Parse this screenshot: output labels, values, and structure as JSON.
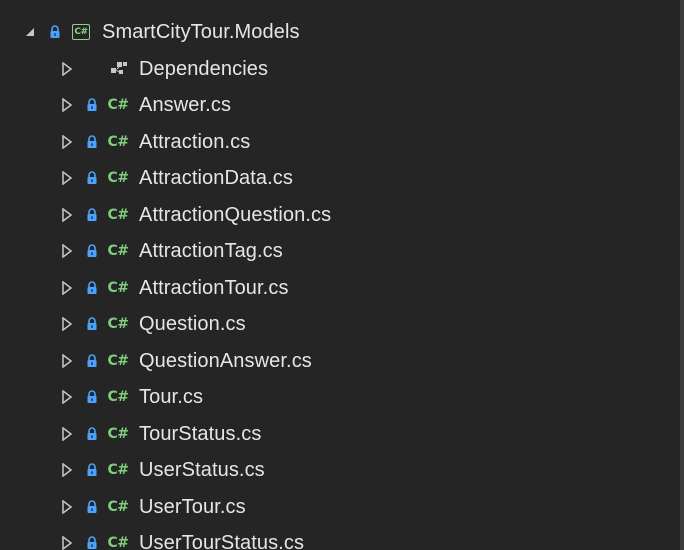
{
  "project": {
    "name": "SmartCityTour.Models",
    "icon": "csharp-project-icon",
    "expanded": true
  },
  "dependencies": {
    "label": "Dependencies",
    "icon": "dependencies-icon"
  },
  "files": [
    {
      "name": "Answer.cs"
    },
    {
      "name": "Attraction.cs"
    },
    {
      "name": "AttractionData.cs"
    },
    {
      "name": "AttractionQuestion.cs"
    },
    {
      "name": "AttractionTag.cs"
    },
    {
      "name": "AttractionTour.cs"
    },
    {
      "name": "Question.cs"
    },
    {
      "name": "QuestionAnswer.cs"
    },
    {
      "name": "Tour.cs"
    },
    {
      "name": "TourStatus.cs"
    },
    {
      "name": "UserStatus.cs"
    },
    {
      "name": "UserTour.cs"
    },
    {
      "name": "UserTourStatus.cs"
    }
  ],
  "csharp_glyph": "C#",
  "project_glyph": "C#",
  "colors": {
    "background": "#252526",
    "text": "#e6e6e6",
    "csharp_green": "#7fcf7a",
    "lock_blue": "#4aa3ff"
  }
}
